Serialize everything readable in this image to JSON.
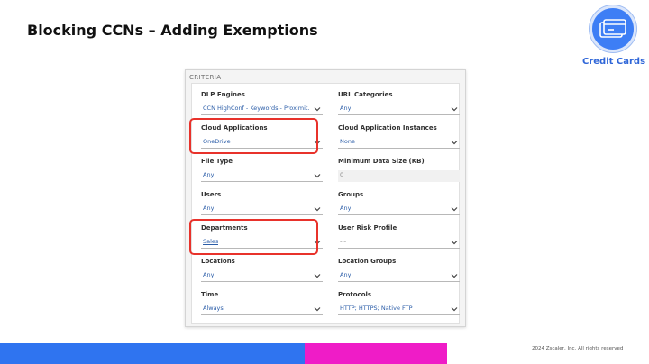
{
  "slide": {
    "title": "Blocking CCNs – Adding Exemptions",
    "badge_label": "Credit Cards",
    "badge_icon": "credit-card-icon",
    "copyright": "2024 Zscaler, Inc. All rights reserved"
  },
  "criteria": {
    "header": "CRITERIA",
    "fields": [
      {
        "label": "DLP Engines",
        "value": "CCN HighConf - Keywords - Proximit...",
        "kind": "select"
      },
      {
        "label": "URL Categories",
        "value": "Any",
        "kind": "select"
      },
      {
        "label": "Cloud Applications",
        "value": "OneDrive",
        "kind": "select",
        "highlighted": true
      },
      {
        "label": "Cloud Application Instances",
        "value": "None",
        "kind": "select"
      },
      {
        "label": "File Type",
        "value": "Any",
        "kind": "select"
      },
      {
        "label": "Minimum Data Size (KB)",
        "value": "0",
        "kind": "input"
      },
      {
        "label": "Users",
        "value": "Any",
        "kind": "select"
      },
      {
        "label": "Groups",
        "value": "Any",
        "kind": "select"
      },
      {
        "label": "Departments",
        "value": "Sales",
        "kind": "select",
        "highlighted": true
      },
      {
        "label": "User Risk Profile",
        "value": "---",
        "kind": "select"
      },
      {
        "label": "Locations",
        "value": "Any",
        "kind": "select"
      },
      {
        "label": "Location Groups",
        "value": "Any",
        "kind": "select"
      },
      {
        "label": "Time",
        "value": "Always",
        "kind": "select"
      },
      {
        "label": "Protocols",
        "value": "HTTP; HTTPS; Native FTP",
        "kind": "select"
      }
    ]
  },
  "colors": {
    "highlight": "#e8322b",
    "value_text": "#2b5da8",
    "bar_blue": "#2f74f0",
    "bar_pink": "#ef1cc7",
    "badge": "#3d7ef5"
  }
}
